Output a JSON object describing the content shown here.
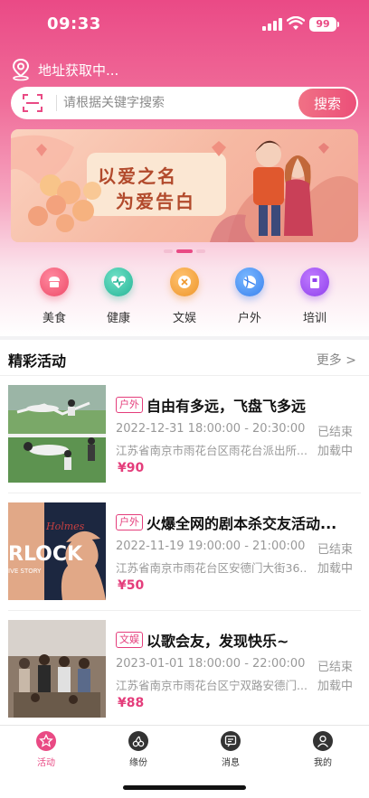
{
  "status_bar": {
    "time": "09:33",
    "battery": "99"
  },
  "location": {
    "text": "地址获取中...",
    "icon": "location-pin-icon"
  },
  "search": {
    "placeholder": "请根据关键字搜索",
    "button_label": "搜索",
    "scan_icon": "scan-icon"
  },
  "banner": {
    "line1": "以爱之名",
    "line2": "为爱告白",
    "carousel_active_index": 1,
    "carousel_count": 3
  },
  "categories": [
    {
      "label": "美食",
      "icon": "cake-icon",
      "color": "#f0506e"
    },
    {
      "label": "健康",
      "icon": "heartbeat-icon",
      "color": "#2fbfa0"
    },
    {
      "label": "文娱",
      "icon": "ticket-icon",
      "color": "#f0a030"
    },
    {
      "label": "户外",
      "icon": "ball-icon",
      "color": "#3f8cf0"
    },
    {
      "label": "培训",
      "icon": "book-icon",
      "color": "#9a4cf0"
    }
  ],
  "section": {
    "title": "精彩活动",
    "more": "更多 >"
  },
  "activities": [
    {
      "tag": "户外",
      "title": "自由有多远，飞盘飞多远",
      "time": "2022-12-31 18:00:00 - 20:30:00",
      "status": "已结束",
      "address": "江苏省南京市雨花台区雨花台派出所...",
      "loading": "加载中",
      "price": "¥90",
      "image": "frisbee-photo"
    },
    {
      "tag": "户外",
      "title": "火爆全网的剧本杀交友活动...",
      "time": "2022-11-19 19:00:00 - 21:00:00",
      "status": "已结束",
      "address": "江苏省南京市雨花台区安德门大街36...",
      "loading": "加载中",
      "price": "¥50",
      "image": "sherlock-poster",
      "image_text_top": "Holmes",
      "image_text_main": "RLOCK",
      "image_text_sub": "IVE STORY"
    },
    {
      "tag": "文娱",
      "title": "以歌会友，发现快乐~",
      "time": "2023-01-01 18:00:00 - 22:00:00",
      "status": "已结束",
      "address": "江苏省南京市雨花台区宁双路安德门...",
      "loading": "加载中",
      "price": "¥88",
      "image": "party-photo"
    }
  ],
  "tabbar": [
    {
      "label": "活动",
      "icon": "star-icon",
      "active": true
    },
    {
      "label": "缘份",
      "icon": "cherry-icon",
      "active": false
    },
    {
      "label": "消息",
      "icon": "message-icon",
      "active": false
    },
    {
      "label": "我的",
      "icon": "user-icon",
      "active": false
    }
  ],
  "colors": {
    "accent": "#e94a84",
    "tag": "#e43d7b",
    "muted": "#999999"
  }
}
